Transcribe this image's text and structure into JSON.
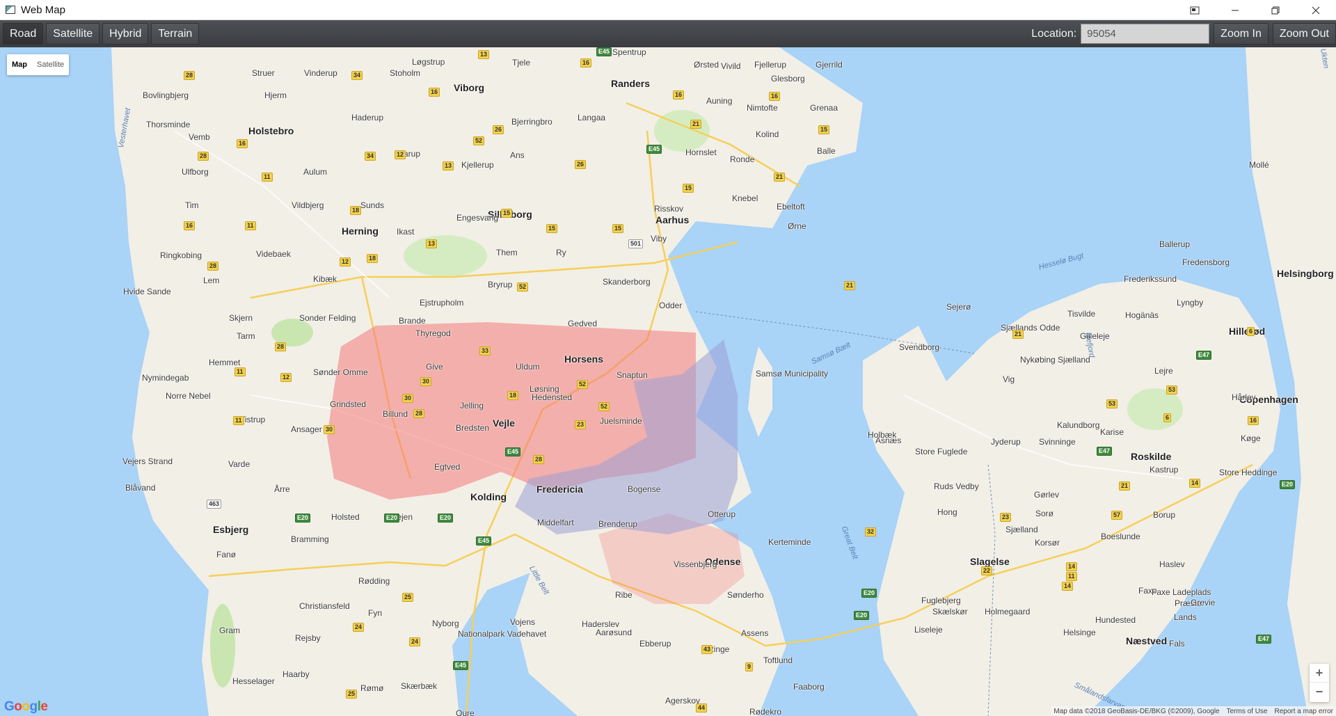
{
  "window": {
    "title": "Web Map",
    "controls": [
      "minimize-icon",
      "restore-icon",
      "close-icon"
    ]
  },
  "toolbar": {
    "map_types": [
      "Road",
      "Satellite",
      "Hybrid",
      "Terrain"
    ],
    "active_type": "Road",
    "location_label": "Location:",
    "location_value": "95054",
    "zoom_in_label": "Zoom In",
    "zoom_out_label": "Zoom Out"
  },
  "map": {
    "type_control": {
      "map_label": "Map",
      "satellite_label": "Satellite"
    },
    "zoom_in_symbol": "+",
    "zoom_out_symbol": "−",
    "logo": "Google",
    "attribution": "Map data ©2018 GeoBasis-DE/BKG (©2009), Google",
    "terms": "Terms of Use",
    "report": "Report a map error",
    "colors": {
      "water": "#a9d3f7",
      "land": "#f2efe6",
      "park": "#c9e6b0",
      "heat_red": "#f47a7a",
      "heat_blue": "#9b9fd6"
    },
    "cities": [
      "Aarhus",
      "Odense",
      "Copenhagen",
      "Esbjerg",
      "Horsens",
      "Vejle",
      "Kolding",
      "Fredericia",
      "Silkeborg",
      "Herning",
      "Randers",
      "Viborg",
      "Holstebro",
      "Slagelse",
      "Helsingborg",
      "Roskilde",
      "Næstved",
      "Hillerød"
    ],
    "towns": [
      "Løgstrup",
      "Tjele",
      "Spentrup",
      "Ørsted",
      "Fjellerup",
      "Gjerrild",
      "Struer",
      "Vinderup",
      "Stoholm",
      "Bovlingbjerg",
      "Hjerm",
      "Haderup",
      "Bjerringbro",
      "Langaa",
      "Auning",
      "Nimtofte",
      "Grenaa",
      "Vivild",
      "Glesborg",
      "Thorsminde",
      "Vemb",
      "Karup",
      "Ans",
      "Kjellerup",
      "Kolind",
      "Hornslet",
      "Ronde",
      "Balle",
      "Ulfborg",
      "Aulum",
      "Mollé",
      "Tim",
      "Vildbjerg",
      "Sunds",
      "Engesvang",
      "Risskov",
      "Knebel",
      "Ebeltoft",
      "Ørne",
      "Ikast",
      "Viby",
      "Ringkobing",
      "Videbaek",
      "Them",
      "Ry",
      "Lem",
      "Kibæk",
      "Bryrup",
      "Skanderborg",
      "Hvide Sande",
      "Ejstrupholm",
      "Odder",
      "Skjern",
      "Sonder Felding",
      "Brande",
      "Gedved",
      "Tarm",
      "Thyregod",
      "Hemmet",
      "Sønder Omme",
      "Give",
      "Uldum",
      "Snaptun",
      "Nymindegab",
      "Samsø Municipality",
      "Norre Nebel",
      "Løsning",
      "Hedensted",
      "Grindsted",
      "Jelling",
      "Tistrup",
      "Billund",
      "Juelsminde",
      "Ansager",
      "Bredsten",
      "Vejers Strand",
      "Varde",
      "Egtved",
      "Blåvand",
      "Årre",
      "Bogense",
      "Holsted",
      "Vejen",
      "Middelfart",
      "Otterup",
      "Bramming",
      "Brenderup",
      "Kerteminde",
      "Fanø",
      "Rødding",
      "Vissenbjerg",
      "Sønderho",
      "Christiansfeld",
      "Ribe",
      "Gram",
      "Fyn",
      "Nyborg",
      "Nationalpark Vadehavet",
      "Vojens",
      "Haderslev",
      "Aarøsund",
      "Assens",
      "Ebberup",
      "Ringe",
      "Rejsby",
      "Toftlund",
      "Haarby",
      "Hesselager",
      "Skærbæk",
      "Rømø",
      "Agerskov",
      "Faaborg",
      "Oure",
      "Rødekro",
      "Svendborg",
      "Sejerø",
      "Sjællands Odde",
      "Nykøbing Sjælland",
      "Vig",
      "Asnæs",
      "Kalundborg",
      "Svinninge",
      "Holbæk",
      "Jyderup",
      "Store Fuglede",
      "Gørlev",
      "Ruds Vedby",
      "Hong",
      "Sorø",
      "Sjælland",
      "Korsør",
      "Boeslunde",
      "Fuglebjerg",
      "Skælskør",
      "Holmegaard",
      "Hundested",
      "Liseleje",
      "Helsinge",
      "Tisvilde",
      "Gilleleje",
      "Hogänäs",
      "Frederikssund",
      "Fredensborg",
      "Ballerup",
      "Lyngby",
      "Lejre",
      "Kastrup",
      "Borup",
      "Køge",
      "Hårlev",
      "Karise",
      "Store Heddinge",
      "Haslev",
      "Faxe",
      "Faxe Ladeplads",
      "Præstø",
      "Grevie",
      "Lands",
      "Fals"
    ],
    "seas": [
      "Vesterhavet",
      "Hesselø Bugt",
      "Samsø Bælt",
      "Great Belt",
      "Little Belt",
      "Isefjord",
      "Smålandsfarvandet",
      "Ukten"
    ],
    "roads": [
      "13",
      "16",
      "28",
      "34",
      "16",
      "E45",
      "16",
      "16",
      "26",
      "52",
      "12",
      "34",
      "16",
      "11",
      "28",
      "13",
      "26",
      "21",
      "E45",
      "15",
      "21",
      "15",
      "18",
      "16",
      "11",
      "15",
      "13",
      "15",
      "15",
      "501",
      "12",
      "18",
      "28",
      "52",
      "21",
      "33",
      "28",
      "11",
      "12",
      "30",
      "30",
      "28",
      "18",
      "52",
      "52",
      "23",
      "11",
      "30",
      "E45",
      "28",
      "21",
      "463",
      "E20",
      "E20",
      "E20",
      "E45",
      "23",
      "57",
      "53",
      "53",
      "6",
      "6",
      "E47",
      "16",
      "E47",
      "21",
      "14",
      "E20",
      "32",
      "11",
      "E20",
      "E20",
      "25",
      "24",
      "24",
      "E45",
      "43",
      "9",
      "14",
      "22",
      "14",
      "E47",
      "25",
      "44"
    ]
  }
}
